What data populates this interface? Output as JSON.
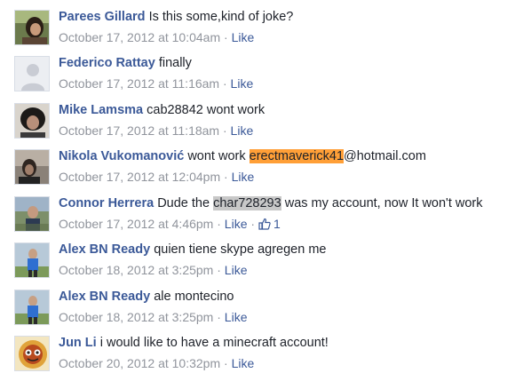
{
  "comments": [
    {
      "author": "Parees Gillard",
      "text": "Is this some,kind of joke?",
      "timestamp": "October 17, 2012 at 10:04am",
      "separator": "·",
      "like_label": "Like",
      "avatar": "photo-person-dark-hair"
    },
    {
      "author": "Federico Rattay",
      "text": "finally",
      "timestamp": "October 17, 2012 at 11:16am",
      "separator": "·",
      "like_label": "Like",
      "avatar": "default-silhouette"
    },
    {
      "author": "Mike Lamsma",
      "text": "cab28842 wont work",
      "timestamp": "October 17, 2012 at 11:18am",
      "separator": "·",
      "like_label": "Like",
      "avatar": "photo-curly-hair"
    },
    {
      "author": "Nikola Vukomanović",
      "text_before": "wont work",
      "highlight": "erectmaverick41",
      "text_after": "@hotmail.com",
      "timestamp": "October 17, 2012 at 12:04pm",
      "separator": "·",
      "like_label": "Like",
      "avatar": "photo-person-dark"
    },
    {
      "author": "Connor Herrera",
      "text_before": "Dude the",
      "highlight": "char728293",
      "text_after": "was my account, now It won't work",
      "timestamp": "October 17, 2012 at 4:46pm",
      "separator": "·",
      "like_label": "Like",
      "like_count": "1",
      "avatar": "photo-person-outdoor"
    },
    {
      "author": "Alex BN Ready",
      "text": "quien tiene skype agregen me",
      "timestamp": "October 18, 2012 at 3:25pm",
      "separator": "·",
      "like_label": "Like",
      "avatar": "photo-child-blue"
    },
    {
      "author": "Alex BN Ready",
      "text": "ale montecino",
      "timestamp": "October 18, 2012 at 3:25pm",
      "separator": "·",
      "like_label": "Like",
      "avatar": "photo-child-blue"
    },
    {
      "author": "Jun Li",
      "text": "i would like to have a minecraft account!",
      "timestamp": "October 20, 2012 at 10:32pm",
      "separator": "·",
      "like_label": "Like",
      "avatar": "cartoon-face"
    }
  ],
  "colors": {
    "author": "#3b5998",
    "text": "#1d2129",
    "meta": "#90949c",
    "highlight_orange": "#ff9f37",
    "highlight_gray": "#c8c8c8"
  }
}
